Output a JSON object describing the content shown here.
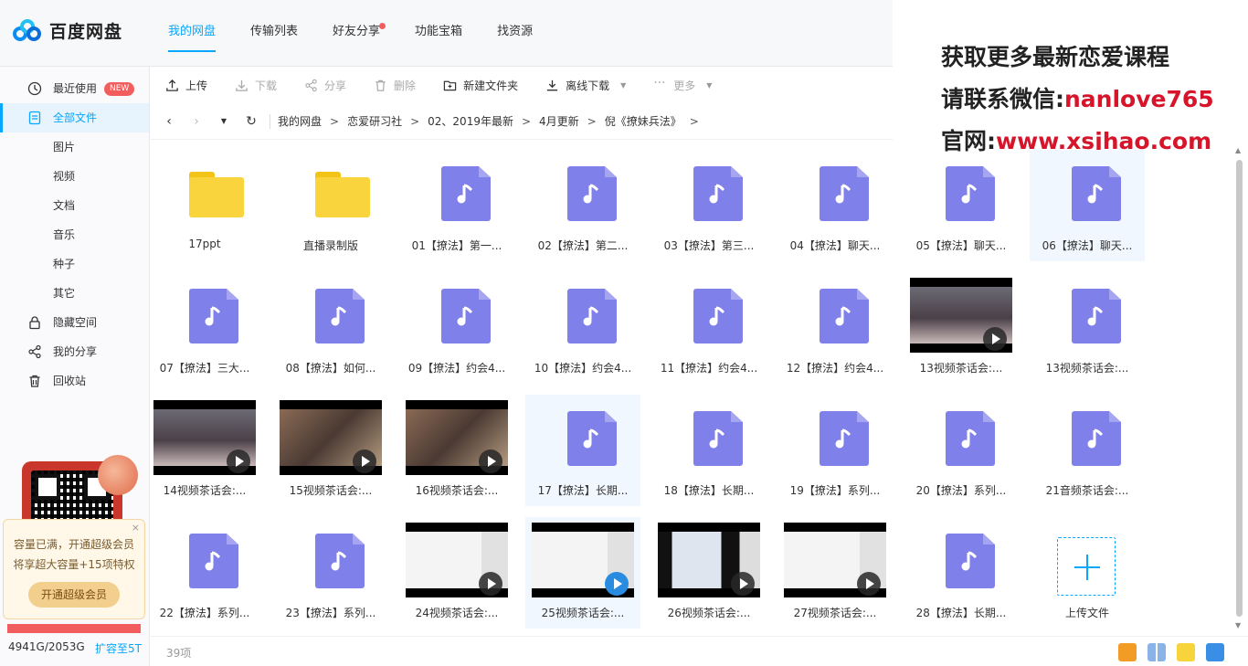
{
  "app": {
    "brand": "百度网盘"
  },
  "topnav": [
    {
      "label": "我的网盘",
      "active": true,
      "dot": false
    },
    {
      "label": "传输列表",
      "active": false,
      "dot": false
    },
    {
      "label": "好友分享",
      "active": false,
      "dot": true
    },
    {
      "label": "功能宝箱",
      "active": false,
      "dot": false
    },
    {
      "label": "找资源",
      "active": false,
      "dot": false
    }
  ],
  "watermark": {
    "line1": "获取更多最新恋爱课程",
    "line2_prefix": "请联系微信:",
    "line2_value": "nanlove765",
    "line3_prefix": "官网:",
    "line3_value": "www.xsjhao.com"
  },
  "sidebar": {
    "recent": {
      "label": "最近使用",
      "badge": "NEW"
    },
    "all_files": "全部文件",
    "sub": [
      "图片",
      "视频",
      "文档",
      "音乐",
      "种子",
      "其它"
    ],
    "hidden": "隐藏空间",
    "share": "我的分享",
    "trash": "回收站",
    "promo": {
      "close": "×",
      "line1": "容量已满，开通超级会员",
      "line2": "将享超大容量+15项特权",
      "button": "开通超级会员"
    },
    "quota": "4941G/2053G",
    "expand": "扩容至5T",
    "quota_used_fraction": 1.0
  },
  "toolbar": {
    "upload": "上传",
    "download": "下载",
    "share": "分享",
    "delete": "删除",
    "new_folder": "新建文件夹",
    "offline": "离线下载",
    "more": "更多"
  },
  "breadcrumb": [
    "我的网盘",
    "恋爱研习社",
    "02、2019年最新",
    "4月更新",
    "倪《撩妹兵法》"
  ],
  "files": [
    {
      "name": "17ppt",
      "type": "folder"
    },
    {
      "name": "直播录制版",
      "type": "folder"
    },
    {
      "name": "01【撩法】第一...",
      "type": "audio"
    },
    {
      "name": "02【撩法】第二...",
      "type": "audio"
    },
    {
      "name": "03【撩法】第三...",
      "type": "audio"
    },
    {
      "name": "04【撩法】聊天...",
      "type": "audio"
    },
    {
      "name": "05【撩法】聊天...",
      "type": "audio"
    },
    {
      "name": "06【撩法】聊天...",
      "type": "audio",
      "selected": true
    },
    {
      "name": "07【撩法】三大...",
      "type": "audio"
    },
    {
      "name": "08【撩法】如何...",
      "type": "audio"
    },
    {
      "name": "09【撩法】约会4...",
      "type": "audio"
    },
    {
      "name": "10【撩法】约会4...",
      "type": "audio"
    },
    {
      "name": "11【撩法】约会4...",
      "type": "audio"
    },
    {
      "name": "12【撩法】约会4...",
      "type": "audio"
    },
    {
      "name": "13视频茶话会:...",
      "type": "video",
      "scene": "room"
    },
    {
      "name": "13视频茶话会:...",
      "type": "audio"
    },
    {
      "name": "14视频茶话会:...",
      "type": "video",
      "scene": "room"
    },
    {
      "name": "15视频茶话会:...",
      "type": "video",
      "scene": "warm"
    },
    {
      "name": "16视频茶话会:...",
      "type": "video",
      "scene": "warm"
    },
    {
      "name": "17【撩法】长期...",
      "type": "audio",
      "selected": true
    },
    {
      "name": "18【撩法】长期...",
      "type": "audio"
    },
    {
      "name": "19【撩法】系列...",
      "type": "audio"
    },
    {
      "name": "20【撩法】系列...",
      "type": "audio"
    },
    {
      "name": "21音频茶话会:...",
      "type": "audio"
    },
    {
      "name": "22【撩法】系列...",
      "type": "audio"
    },
    {
      "name": "23【撩法】系列...",
      "type": "audio"
    },
    {
      "name": "24视频茶话会:...",
      "type": "video",
      "scene": "screen"
    },
    {
      "name": "25视频茶话会:...",
      "type": "video",
      "scene": "screen",
      "selected": true,
      "play": "blue"
    },
    {
      "name": "26视频茶话会:...",
      "type": "video",
      "scene": "dark"
    },
    {
      "name": "27视频茶话会:...",
      "type": "video",
      "scene": "screen"
    },
    {
      "name": "28【撩法】长期...",
      "type": "audio"
    },
    {
      "name": "上传文件",
      "type": "upload"
    }
  ],
  "status": {
    "count": "39项"
  },
  "colors": {
    "accent": "#06a7ff",
    "audio": "#8080ea",
    "folder": "#fad43c",
    "danger": "#f25d5d"
  }
}
